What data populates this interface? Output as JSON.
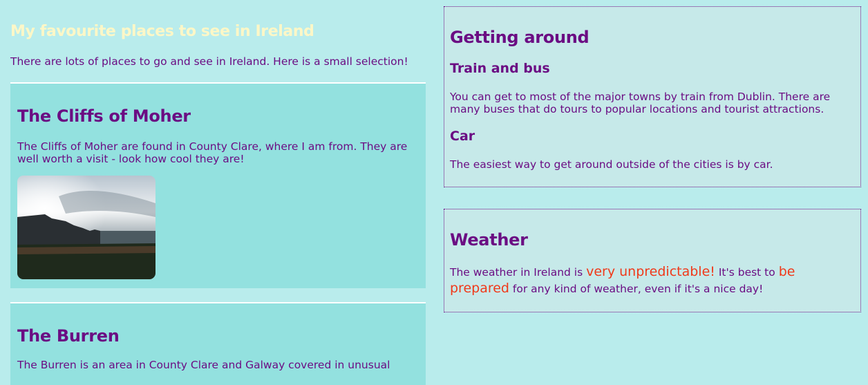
{
  "page": {
    "title": "My favourite places to see in Ireland",
    "intro": "There are lots of places to go and see in Ireland. Here is a small selection!"
  },
  "places": [
    {
      "heading": "The Cliffs of Moher",
      "text": "The Cliffs of Moher are found in County Clare, where I am from. They are well worth a visit - look how cool they are!"
    },
    {
      "heading": "The Burren",
      "text": "The Burren is an area in County Clare and Galway covered in unusual"
    }
  ],
  "getting_around": {
    "heading": "Getting around",
    "train_heading": "Train and bus",
    "train_text": "You can get to most of the major towns by train from Dublin. There are many buses that do tours to popular locations and tourist attractions.",
    "car_heading": "Car",
    "car_text": "The easiest way to get around outside of the cities is by car."
  },
  "weather": {
    "heading": "Weather",
    "text_1": "The weather in Ireland is ",
    "highlight_1": "very unpredictable!",
    "text_2": " It's best to ",
    "highlight_2": "be prepared",
    "text_3": " for any kind of weather, even if it's a nice day!"
  },
  "colors": {
    "background": "#b9ecec",
    "card": "#93e1df",
    "text": "#6b0d83",
    "title": "#fdf7c7",
    "highlight": "#f0391a"
  }
}
